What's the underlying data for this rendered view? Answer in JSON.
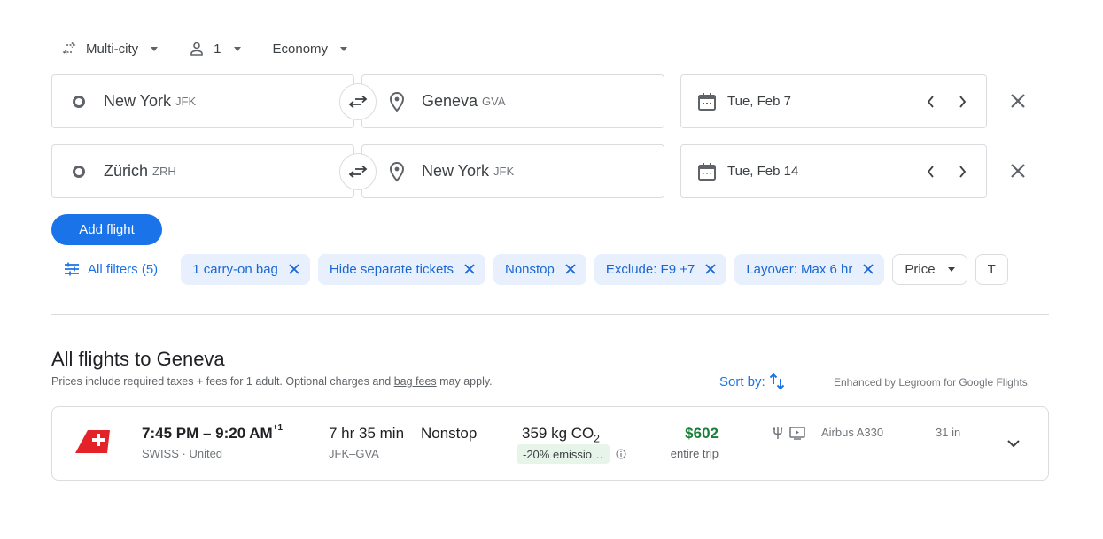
{
  "search": {
    "trip_type": "Multi-city",
    "passengers": "1",
    "cabin_class": "Economy",
    "legs": [
      {
        "origin_city": "New York",
        "origin_code": "JFK",
        "dest_city": "Geneva",
        "dest_code": "GVA",
        "date": "Tue, Feb 7"
      },
      {
        "origin_city": "Zürich",
        "origin_code": "ZRH",
        "dest_city": "New York",
        "dest_code": "JFK",
        "date": "Tue, Feb 14"
      }
    ],
    "add_flight_label": "Add flight"
  },
  "filters": {
    "all_filters_label": "All filters (5)",
    "chips": [
      {
        "label": "1 carry-on bag"
      },
      {
        "label": "Hide separate tickets"
      },
      {
        "label": "Nonstop"
      },
      {
        "label": "Exclude: F9 +7"
      },
      {
        "label": "Layover: Max 6 hr"
      }
    ],
    "dropdowns": [
      {
        "label": "Price"
      },
      {
        "label": "T"
      }
    ]
  },
  "results": {
    "title": "All flights to Geneva",
    "subtitle_before": "Prices include required taxes + fees for 1 adult. Optional charges and ",
    "subtitle_link": "bag fees",
    "subtitle_after": " may apply.",
    "sort_label": "Sort by:",
    "enhanced_note": "Enhanced by Legroom for Google Flights.",
    "flights": [
      {
        "airline_logo": "swiss-logo",
        "times": "7:45 PM – 9:20 AM",
        "day_offset": "+1",
        "airlines": "SWISS · United",
        "duration": "7 hr 35 min",
        "route": "JFK–GVA",
        "stops": "Nonstop",
        "co2_value": "359 kg CO",
        "co2_sub": "2",
        "emissions_badge": "-20% emissio…",
        "price": "$602",
        "price_note": "entire trip",
        "amenities": [
          "usb-power-icon",
          "video-screen-icon"
        ],
        "aircraft": "Airbus A330",
        "legroom": "31 in"
      }
    ]
  },
  "colors": {
    "accent": "#1a73e8",
    "chip_bg": "#e8f0fe",
    "chip_text": "#1967d2",
    "price_green": "#188038",
    "emissions_bg": "#e6f4ea",
    "swiss_red": "#e3222a"
  }
}
